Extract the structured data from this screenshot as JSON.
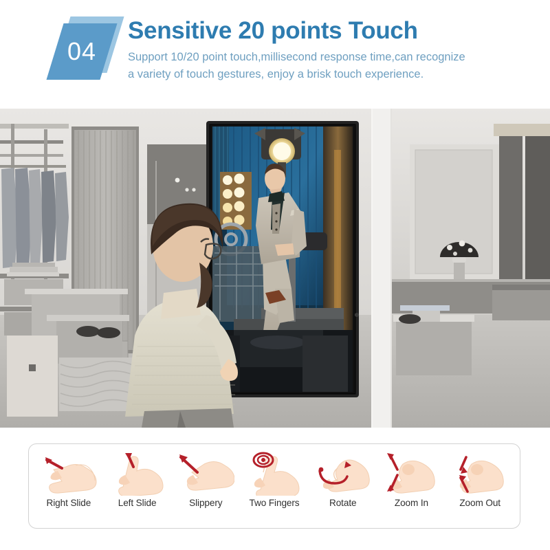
{
  "header": {
    "badge_number": "04",
    "title": "Sensitive 20 points Touch",
    "subtitle_line1": "Support 10/20 point touch,millisecond response time,can recognize",
    "subtitle_line2": "a variety of touch gestures, enjoy a brisk touch experience.",
    "colors": {
      "badge_front": "#5b9bc9",
      "badge_back": "#9cc6e2",
      "title": "#2e7cb0",
      "subtitle": "#6e9fc0"
    }
  },
  "photo": {
    "alt": "Man in cream sweater viewing a wall-mounted vertical touch display kiosk in a desaturated clothing store; the kiosk shows a full-color photo of a man in a light grey three-piece suit seated in a film studio with blue backdrop and stage lights",
    "scene": {
      "left_section": "clothing racks and shelving in grey store interior",
      "center_section": "black-framed portrait-orientation touch display kiosk on wall",
      "right_section": "counter with mushroom lamp, dark cabinetry, display tables with shoes",
      "foreground_person": "man seen from behind wearing glasses, cream knit sweater and grey jeans"
    },
    "kiosk_content": {
      "subject": "man in light grey suit with waistcoat and dark shirt",
      "setting": "film studio with blue curtain backdrop, spotlight, vanity bulb lights and film reel equipment"
    }
  },
  "gesture_panel": {
    "gestures": [
      {
        "label": "Right Slide",
        "icon": "hand-right-slide-icon"
      },
      {
        "label": "Left Slide",
        "icon": "hand-left-slide-icon"
      },
      {
        "label": "Slippery",
        "icon": "hand-slippery-icon"
      },
      {
        "label": "Two Fingers",
        "icon": "hand-two-fingers-icon"
      },
      {
        "label": "Rotate",
        "icon": "hand-rotate-icon"
      },
      {
        "label": "Zoom In",
        "icon": "hand-zoom-in-icon"
      },
      {
        "label": "Zoom Out",
        "icon": "hand-zoom-out-icon"
      }
    ],
    "colors": {
      "border": "#d2d2d2",
      "arrow": "#b5202a",
      "skin": "#f8ddc8",
      "label": "#303030"
    }
  }
}
